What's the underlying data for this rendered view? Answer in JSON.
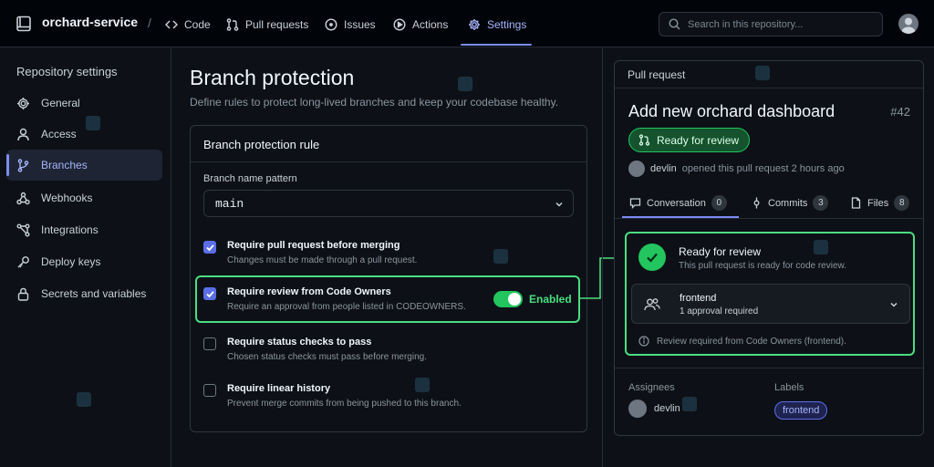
{
  "repo": {
    "name": "orchard-service",
    "separator": "/"
  },
  "nav": {
    "items": [
      {
        "label": "Code",
        "icon": "code-icon"
      },
      {
        "label": "Pull requests",
        "icon": "pull-request-icon"
      },
      {
        "label": "Issues",
        "icon": "issue-icon"
      },
      {
        "label": "Actions",
        "icon": "play-icon"
      },
      {
        "label": "Settings",
        "icon": "gear-icon",
        "active": true
      }
    ]
  },
  "search": {
    "placeholder": "Search in this repository..."
  },
  "sidebar": {
    "heading": "Repository settings",
    "items": [
      {
        "label": "General",
        "icon": "gear-icon"
      },
      {
        "label": "Access",
        "icon": "person-icon"
      },
      {
        "label": "Branches",
        "icon": "branch-icon",
        "active": true
      },
      {
        "label": "Webhooks",
        "icon": "webhook-icon"
      },
      {
        "label": "Integrations",
        "icon": "integrations-icon"
      },
      {
        "label": "Deploy keys",
        "icon": "key-icon"
      },
      {
        "label": "Secrets and variables",
        "icon": "lock-icon"
      }
    ]
  },
  "main": {
    "title": "Branch protection",
    "subtitle": "Define rules to protect long-lived branches and keep your codebase healthy.",
    "card_title": "Branch protection rule",
    "pattern_label": "Branch name pattern",
    "pattern_value": "main",
    "options": [
      {
        "title": "Require pull request before merging",
        "desc": "Changes must be made through a pull request.",
        "checked": true
      },
      {
        "title": "Require review from Code Owners",
        "desc": "Require an approval from people listed in CODEOWNERS.",
        "checked": true
      },
      {
        "title": "Require status checks to pass",
        "desc": "Chosen status checks must pass before merging.",
        "checked": false
      },
      {
        "title": "Require linear history",
        "desc": "Prevent merge commits from being pushed to this branch.",
        "checked": false
      }
    ],
    "toggle_label": "Enabled"
  },
  "pr": {
    "panel_title": "Pull request",
    "title": "Add new orchard dashboard",
    "number": "#42",
    "status": "Ready for review",
    "author": "devlin",
    "opened_text": "opened this pull request 2 hours ago",
    "tabs": [
      {
        "label": "Conversation",
        "count": "0"
      },
      {
        "label": "Commits",
        "count": "3"
      },
      {
        "label": "Files",
        "count": "8"
      }
    ],
    "review": {
      "title": "Ready for review",
      "subtitle": "This pull request is ready for code review.",
      "team": "frontend",
      "requirement": "1 approval required",
      "note": "Review required from Code Owners (frontend)."
    },
    "assignees_label": "Assignees",
    "assignee": "devlin",
    "labels_label": "Labels",
    "label": "frontend"
  },
  "colors": {
    "accent": "#7c8cf5",
    "success": "#4ade80",
    "background": "#0d1117"
  }
}
